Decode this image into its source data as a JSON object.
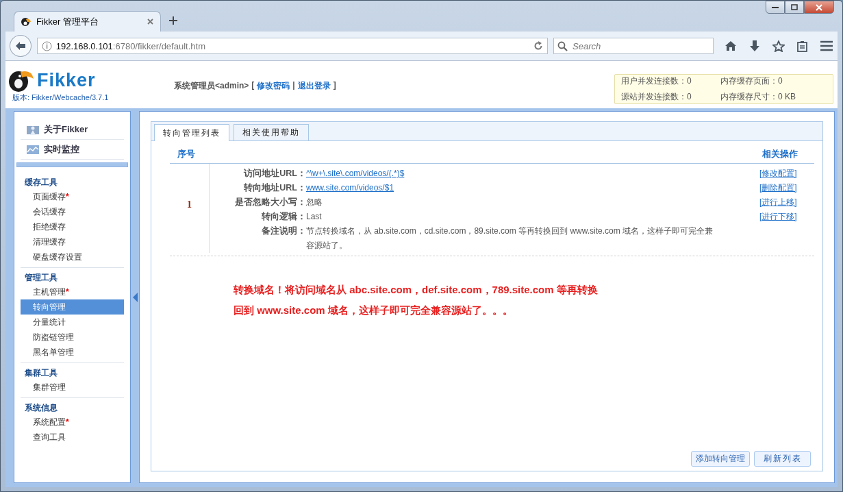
{
  "browser": {
    "tab_title": "Fikker 管理平台",
    "url_host": "192.168.0.101",
    "url_rest": ":6780/fikker/default.htm",
    "search_placeholder": "Search"
  },
  "header": {
    "logo_text": "Fikker",
    "version_label": "版本:",
    "version": "Fikker/Webcache/3.7.1",
    "user": "系统管理员<admin>",
    "open_bracket": "[",
    "links": [
      "修改密码",
      "退出登录"
    ],
    "separator": "|",
    "close_bracket": "]",
    "stats": [
      "用户并发连接数：0",
      "内存缓存页面：0",
      "源站并发连接数：0",
      "内存缓存尺寸：0 KB"
    ]
  },
  "sidebar": {
    "top_items": [
      {
        "label": "关于Fikker",
        "kind": "about"
      },
      {
        "label": "实时监控",
        "kind": "monitor"
      }
    ],
    "sections": [
      {
        "title": "缓存工具",
        "items": [
          {
            "label": "页面缓存",
            "badge": "*",
            "selected": false
          },
          {
            "label": "会话缓存",
            "selected": false
          },
          {
            "label": "拒绝缓存",
            "selected": false
          },
          {
            "label": "清理缓存",
            "selected": false
          },
          {
            "label": "硬盘缓存设置",
            "selected": false
          }
        ]
      },
      {
        "title": "管理工具",
        "items": [
          {
            "label": "主机管理",
            "badge": "*",
            "selected": false
          },
          {
            "label": "转向管理",
            "selected": true
          },
          {
            "label": "分量统计",
            "selected": false
          },
          {
            "label": "防盗链管理",
            "selected": false
          },
          {
            "label": "黑名单管理",
            "selected": false
          }
        ]
      },
      {
        "title": "集群工具",
        "items": [
          {
            "label": "集群管理",
            "selected": false
          }
        ]
      },
      {
        "title": "系统信息",
        "items": [
          {
            "label": "系统配置",
            "badge": "*",
            "selected": false
          },
          {
            "label": "查询工具",
            "selected": false
          }
        ]
      }
    ]
  },
  "tabs": [
    {
      "label": "转向管理列表",
      "selected": true
    },
    {
      "label": "相关使用帮助",
      "selected": false
    }
  ],
  "table": {
    "columns": [
      "序号",
      "相关操作"
    ],
    "rows": [
      {
        "index": "1",
        "fields": [
          {
            "label": "访问地址URL：",
            "value": "^\\w+\\.site\\.com/videos/(.*)$",
            "kind": "link"
          },
          {
            "label": "转向地址URL：",
            "value": "www.site.com/videos/$1",
            "kind": "link"
          },
          {
            "label": "是否忽略大小写：",
            "value": "忽略",
            "kind": "text"
          },
          {
            "label": "转向逻辑：",
            "value": "Last",
            "kind": "text"
          },
          {
            "label": "备注说明：",
            "value": "节点转换域名，从 ab.site.com，cd.site.com，89.site.com 等再转换回到 www.site.com 域名，这样子即可完全兼容源站了。",
            "kind": "text"
          }
        ],
        "actions": [
          "[修改配置]",
          "[删除配置]",
          "[进行上移]",
          "[进行下移]"
        ]
      }
    ]
  },
  "note": [
    "转换域名！将访问域名从 abc.site.com，def.site.com，789.site.com 等再转换",
    "回到 www.site.com 域名，这样子即可完全兼容源站了。。。"
  ],
  "buttons": [
    "添加转向管理",
    "刷新列表"
  ]
}
